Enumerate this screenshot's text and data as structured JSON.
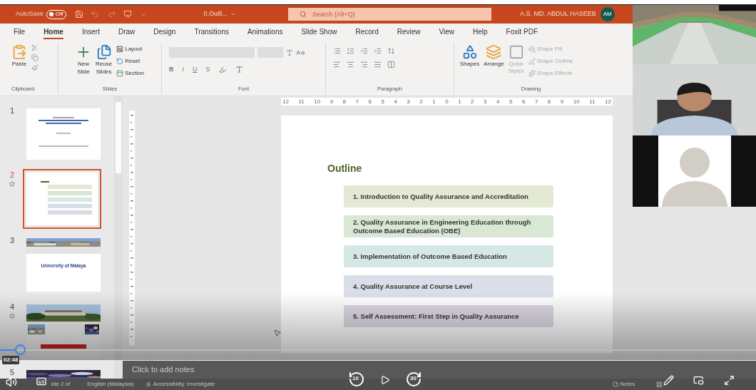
{
  "title_bar": {
    "autosave_label": "AutoSave",
    "autosave": {
      "on": false,
      "label": "Off"
    },
    "document_title": "0.Outli...",
    "search": {
      "placeholder": "Search (Alt+Q)"
    },
    "user_name": "A.S. MD. ABDUL HASEEB",
    "user_initials": "AM"
  },
  "tabs": [
    {
      "label": "File",
      "selected": false
    },
    {
      "label": "Home",
      "selected": true
    },
    {
      "label": "Insert",
      "selected": false
    },
    {
      "label": "Draw",
      "selected": false
    },
    {
      "label": "Design",
      "selected": false
    },
    {
      "label": "Transitions",
      "selected": false
    },
    {
      "label": "Animations",
      "selected": false
    },
    {
      "label": "Slide Show",
      "selected": false
    },
    {
      "label": "Record",
      "selected": false
    },
    {
      "label": "Review",
      "selected": false
    },
    {
      "label": "View",
      "selected": false
    },
    {
      "label": "Help",
      "selected": false
    },
    {
      "label": "Foxit PDF",
      "selected": false
    }
  ],
  "ribbon": {
    "clipboard": {
      "label": "Clipboard",
      "paste": "Paste"
    },
    "slides": {
      "label": "Slides",
      "new_slide": [
        "New",
        "Slide"
      ],
      "reuse_slides": [
        "Reuse",
        "Slides"
      ],
      "layout": "Layout",
      "reset": "Reset",
      "section": "Section"
    },
    "font": {
      "label": "Font",
      "format_buttons": [
        "B",
        "I",
        "U",
        "S"
      ]
    },
    "paragraph": {
      "label": "Paragraph"
    },
    "drawing": {
      "label": "Drawing",
      "shapes": "Shapes",
      "arrange": "Arrange",
      "quick_styles": {
        "label": [
          "Quick",
          "Styles"
        ],
        "disabled": true
      },
      "shape_commands": [
        {
          "label": "Shape Fill",
          "disabled": true
        },
        {
          "label": "Shape Outline",
          "disabled": true
        },
        {
          "label": "Shape Effects",
          "disabled": true
        }
      ]
    }
  },
  "ruler_labels": [
    "12",
    "11",
    "10",
    "9",
    "8",
    "7",
    "6",
    "5",
    "4",
    "3",
    "2",
    "1",
    "0",
    "1",
    "2",
    "3",
    "4",
    "5",
    "6",
    "7",
    "8",
    "9",
    "10",
    "11",
    "12"
  ],
  "thumbnails": [
    {
      "number": "1",
      "kind": "title",
      "selected": false,
      "animated": false
    },
    {
      "number": "2",
      "kind": "outline",
      "selected": true,
      "animated": true
    },
    {
      "number": "3",
      "kind": "banner",
      "selected": false,
      "animated": false,
      "caption": "University of Malaya"
    },
    {
      "number": "4",
      "kind": "photos",
      "selected": false,
      "animated": true
    },
    {
      "number": "5",
      "selected": false,
      "animated": false
    }
  ],
  "slide": {
    "title": "Outline",
    "items": [
      {
        "text": "1. Introduction to Quality Assurance and Accreditation",
        "color": "#e3e9d2"
      },
      {
        "text": "2. Quality Assurance in Engineering Education through Outcome Based Education (OBE)",
        "color": "#d8e8d5"
      },
      {
        "text": "3. Implementation of Outcome Based Education",
        "color": "#d5e8e6"
      },
      {
        "text": "4. Quality Assurance at Course Level",
        "color": "#d9dee9"
      },
      {
        "text": "5. Self Assessment: First Step in Quality Assurance",
        "color": "#ddd8e3"
      }
    ]
  },
  "notes": {
    "placeholder": "Click to add notes"
  },
  "status_bar": {
    "slide_indicator": "ide 2 of",
    "language": "English (Malaysia)",
    "accessibility": "Accessibility: Investigate",
    "notes_button": "Notes"
  },
  "video": {
    "level": 0.02,
    "time": "02:48",
    "rewind_label": "10",
    "forward_label": "30"
  }
}
